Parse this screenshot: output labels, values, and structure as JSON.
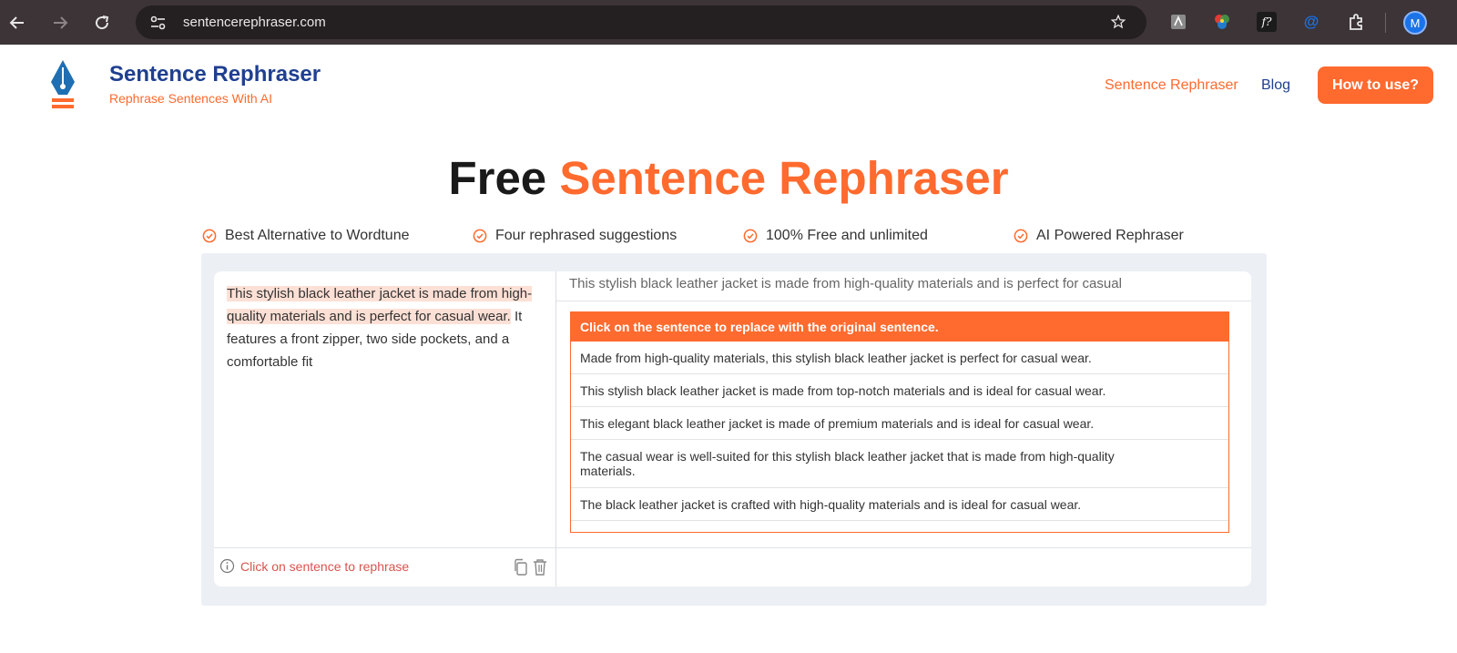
{
  "browser": {
    "url": "sentencerephraser.com",
    "profile_initial": "M",
    "icons": [
      "back-icon",
      "forward-icon",
      "reload-icon",
      "site-info-icon",
      "bookmark-star-icon",
      "extension-1-icon",
      "extension-color-icon",
      "extension-fx-icon",
      "extension-at-icon",
      "extensions-puzzle-icon"
    ]
  },
  "header": {
    "brand_title": "Sentence Rephraser",
    "brand_subtitle": "Rephrase Sentences With AI",
    "nav": [
      {
        "label": "Sentence Rephraser",
        "active": true
      },
      {
        "label": "Blog",
        "active": false
      }
    ],
    "cta_label": "How to use?"
  },
  "hero": {
    "title_part1": "Free",
    "title_part2": "Sentence Rephraser"
  },
  "features": [
    "Best Alternative to Wordtune",
    "Four rephrased suggestions",
    "100% Free and unlimited",
    "AI Powered Rephraser"
  ],
  "editor": {
    "highlighted_sentence": "This stylish black leather jacket is made from high-quality materials and is perfect for casual wear.",
    "rest_text": " It features a front zipper, two side pockets, and a comfortable fit",
    "status_text": "Click on sentence to rephrase"
  },
  "output": {
    "selected_sentence": "This stylish black leather jacket is made from high-quality materials and is perfect for casual wear.",
    "suggestions_header": "Click on the sentence to replace with the original sentence.",
    "suggestions": [
      "Made from high-quality materials, this stylish black leather jacket is perfect for casual wear.",
      "This stylish black leather jacket is made from top-notch materials and is ideal for casual wear.",
      "This elegant black leather jacket is made of premium materials and is ideal for casual wear.",
      "The casual wear is well-suited for this stylish black leather jacket that is made from high-quality materials.",
      "The black leather jacket is crafted with high-quality materials and is ideal for casual wear."
    ]
  },
  "colors": {
    "accent": "#ff6a2e",
    "brand_blue": "#1f3f8f",
    "highlight": "#fde0d5",
    "chrome_bar": "#3c3437"
  }
}
